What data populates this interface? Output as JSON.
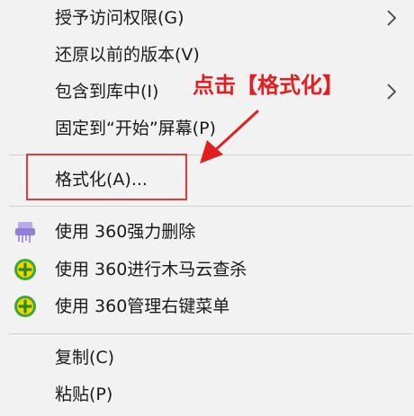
{
  "context_menu": {
    "items": [
      {
        "label": "授予访问权限(G)",
        "has_submenu": true
      },
      {
        "label": "还原以前的版本(V)",
        "has_submenu": false
      },
      {
        "label": "包含到库中(I)",
        "has_submenu": true
      },
      {
        "label": "固定到“开始”屏幕(P)",
        "has_submenu": false
      },
      {
        "label": "格式化(A)...",
        "has_submenu": false
      },
      {
        "label": "使用 360强力删除",
        "icon": "shredder-icon"
      },
      {
        "label": "使用 360进行木马云查杀",
        "icon": "360-plus-icon"
      },
      {
        "label": "使用 360管理右键菜单",
        "icon": "360-plus-icon"
      },
      {
        "label": "复制(C)"
      },
      {
        "label": "粘贴(P)"
      }
    ]
  },
  "annotation": {
    "text": "点击【格式化】",
    "color": "#e02020"
  },
  "colors": {
    "menu_background": "#f2f2f2",
    "highlight_border": "#e23a3a"
  }
}
